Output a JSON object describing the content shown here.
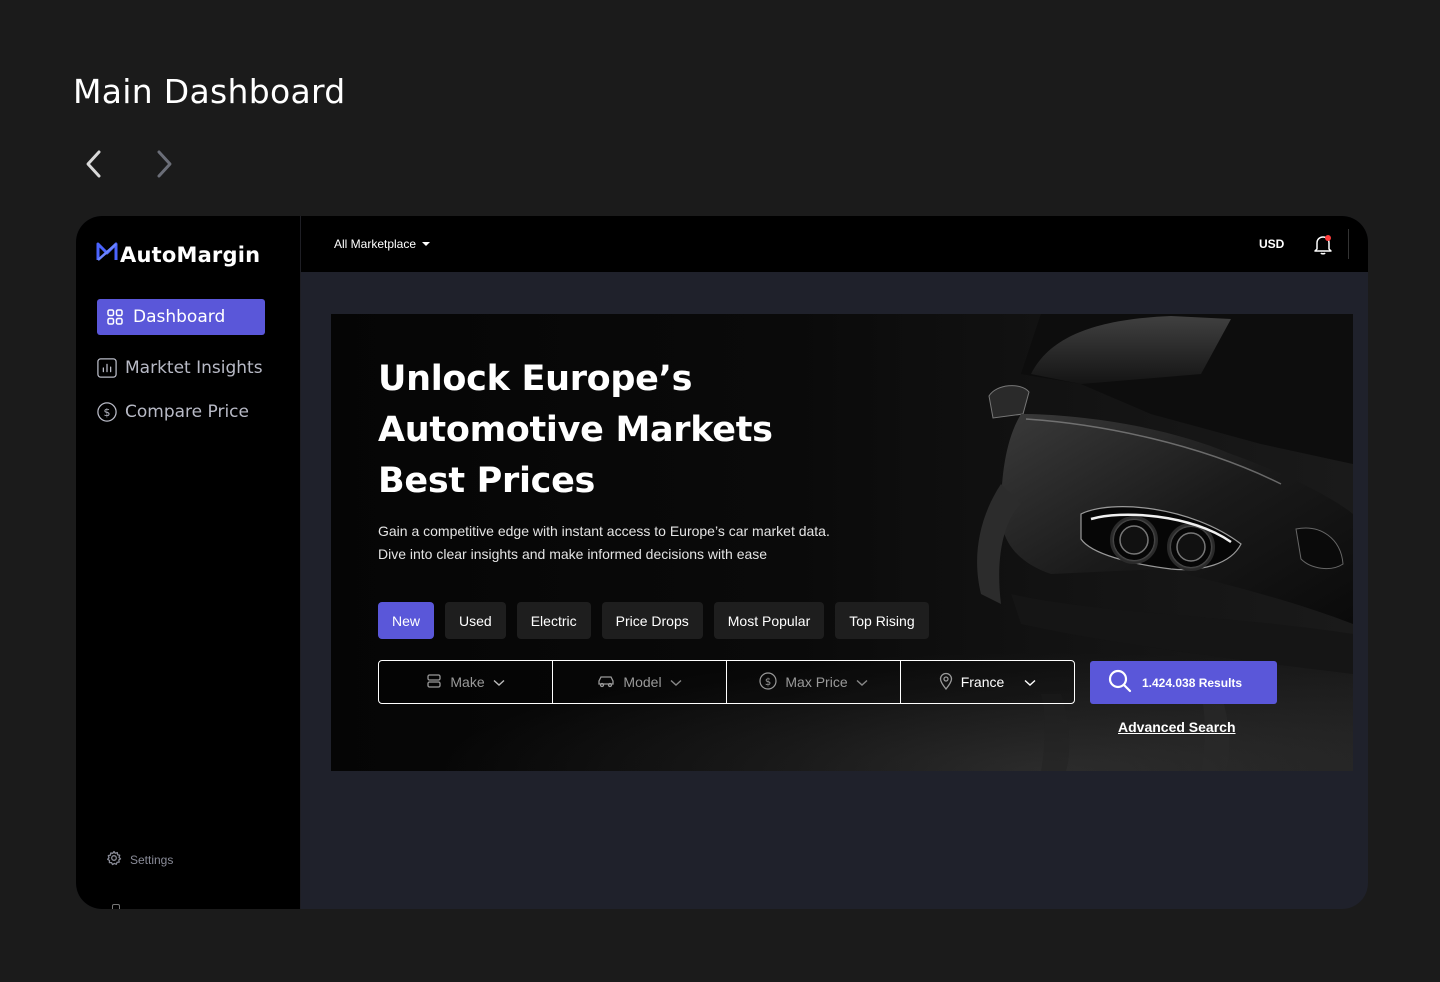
{
  "page": {
    "title": "Main Dashboard"
  },
  "nav": {
    "back_icon": "chevron-left-icon",
    "forward_icon": "chevron-right-icon"
  },
  "app": {
    "brand": "AutoMargin",
    "accent_color": "#5a57d9",
    "sidebar": {
      "items": [
        {
          "label": "Dashboard",
          "icon": "grid-icon",
          "active": true
        },
        {
          "label": "Marktet Insights",
          "icon": "bar-chart-icon",
          "active": false
        },
        {
          "label": "Compare Price",
          "icon": "dollar-circle-icon",
          "active": false
        }
      ],
      "settings_label": "Settings"
    },
    "topbar": {
      "marketplace": "All Marketplace",
      "currency": "USD",
      "bell_icon": "bell-icon"
    },
    "hero": {
      "title": "Unlock Europe’s Automotive Markets Best Prices",
      "description": "Gain a competitive edge with instant access to Europe’s car market data. Dive into clear insights and make informed decisions with ease",
      "chips": [
        {
          "label": "New",
          "active": true
        },
        {
          "label": "Used",
          "active": false
        },
        {
          "label": "Electric",
          "active": false
        },
        {
          "label": "Price Drops",
          "active": false
        },
        {
          "label": "Most Popular",
          "active": false
        },
        {
          "label": "Top Rising",
          "active": false
        }
      ],
      "filters": {
        "make": "Make",
        "model": "Model",
        "max_price": "Max Price",
        "country": "France"
      },
      "search_button": "1.424.038 Results",
      "advanced_search": "Advanced Search"
    }
  }
}
